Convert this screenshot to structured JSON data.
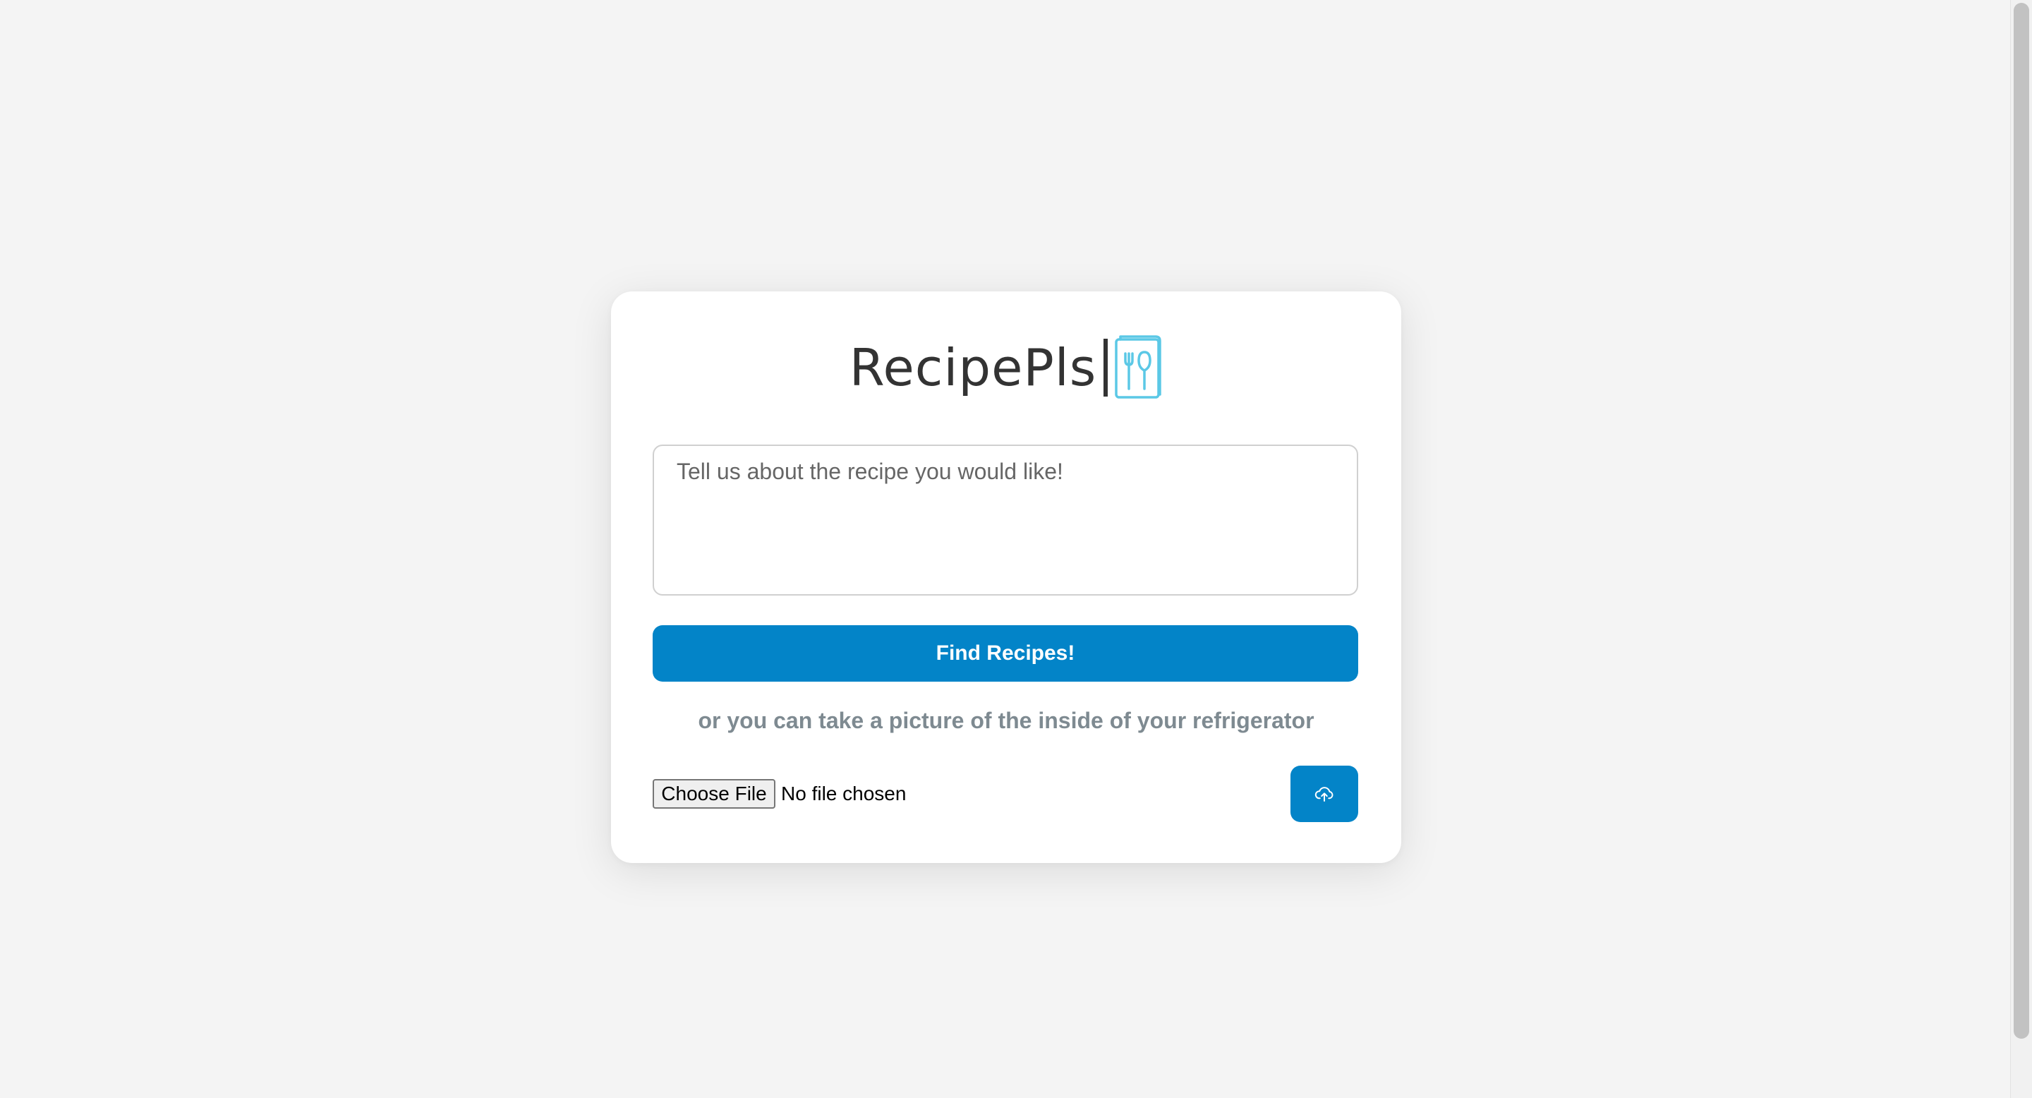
{
  "app": {
    "logo_text": "RecipePls",
    "logo_icon": "recipe-book-utensils-icon",
    "accent_color": "#0384c8",
    "logo_icon_color": "#5bc8e6"
  },
  "form": {
    "textarea_placeholder": "Tell us about the recipe you would like!",
    "textarea_value": "",
    "find_button_label": "Find Recipes!",
    "alt_text": "or you can take a picture of the inside of your refrigerator",
    "file_button_label": "Choose File",
    "file_status": "No file chosen",
    "upload_icon": "cloud-upload-icon"
  }
}
